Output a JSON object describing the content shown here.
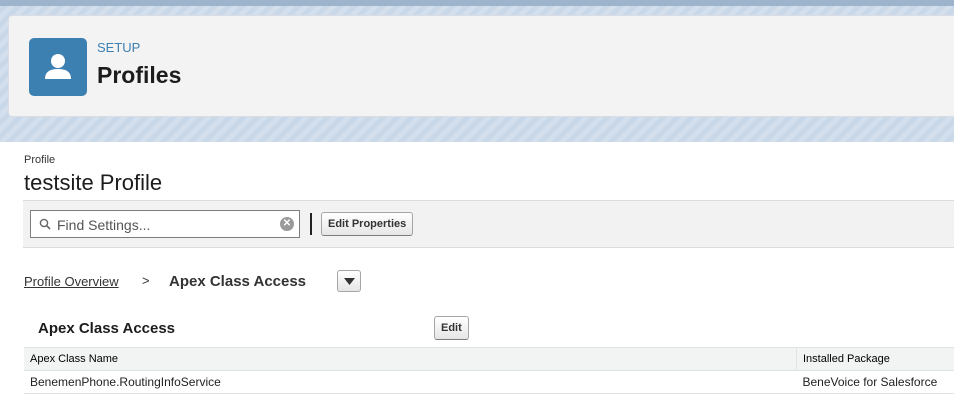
{
  "header": {
    "breadcrumb_label": "SETUP",
    "title": "Profiles",
    "icon": "user-icon"
  },
  "record": {
    "label": "Profile",
    "name": "testsite Profile"
  },
  "toolbar": {
    "search_placeholder": "Find Settings...",
    "clear_icon": "clear-icon",
    "edit_properties_label": "Edit Properties"
  },
  "breadcrumb": {
    "parent_label": "Profile Overview",
    "separator": ">",
    "current_label": "Apex Class Access"
  },
  "section": {
    "title": "Apex Class Access",
    "edit_label": "Edit"
  },
  "table": {
    "columns": [
      "Apex Class Name",
      "Installed Package"
    ],
    "rows": [
      [
        "BenemenPhone.RoutingInfoService",
        "BeneVoice for Salesforce"
      ]
    ]
  },
  "colors": {
    "accent": "#3c7fb1",
    "header_background": "#f3f3f3",
    "band_background": "#c9d8e8"
  }
}
